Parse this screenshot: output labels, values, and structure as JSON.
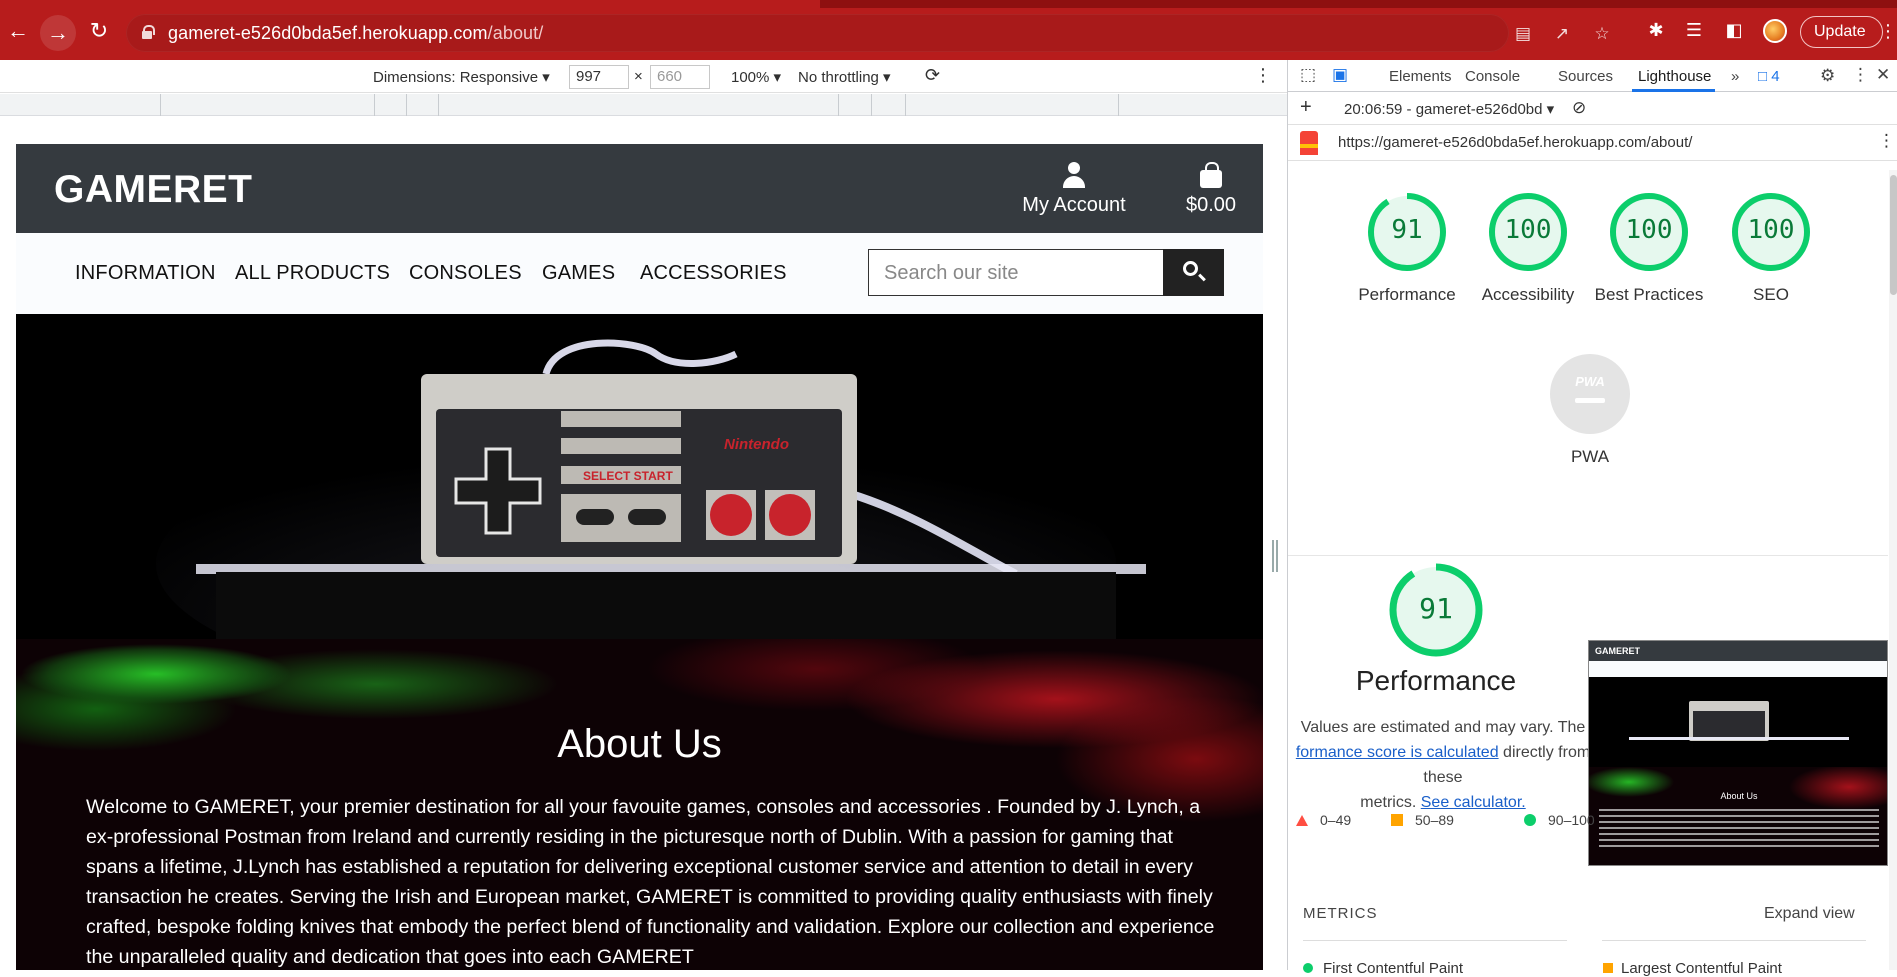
{
  "browser": {
    "url_host": "gameret-e526d0bda5ef.herokuapp.com",
    "url_path": "/about/",
    "update_label": "Update"
  },
  "device_toolbar": {
    "dimensions_label": "Dimensions: Responsive",
    "width_value": "997",
    "height_placeholder": "660",
    "zoom": "100%",
    "throttling": "No throttling"
  },
  "devtools": {
    "tabs": [
      "Elements",
      "Console",
      "Sources",
      "Lighthouse"
    ],
    "issues_count": "4",
    "report_time": "20:06:59 - gameret-e526d0bd",
    "report_url": "https://gameret-e526d0bda5ef.herokuapp.com/about/",
    "scores": [
      {
        "label": "Performance",
        "value": "91",
        "fraction": 0.91
      },
      {
        "label": "Accessibility",
        "value": "100",
        "fraction": 1.0
      },
      {
        "label": "Best Practices",
        "value": "100",
        "fraction": 1.0
      },
      {
        "label": "SEO",
        "value": "100",
        "fraction": 1.0
      }
    ],
    "pwa_badge": "PWA",
    "pwa_label": "PWA",
    "perf_score": "91",
    "perf_title": "Performance",
    "perf_note_1": "Values are estimated and may vary. The",
    "perf_note_link": "formance score is calculated",
    "perf_note_2": "directly from these",
    "perf_note_3": "metrics.",
    "perf_note_link2": "See calculator.",
    "legend": {
      "fail": "0–49",
      "average": "50–89",
      "pass": "90–100"
    },
    "metrics_heading": "METRICS",
    "expand_view": "Expand view",
    "metric_fcp": "First Contentful Paint",
    "metric_lcp": "Largest Contentful Paint",
    "thumb_about": "About Us"
  },
  "site": {
    "brand": "GAMERET",
    "account_label": "My Account",
    "cart_total": "$0.00",
    "nav": [
      "INFORMATION",
      "ALL PRODUCTS",
      "CONSOLES",
      "GAMES",
      "ACCESSORIES"
    ],
    "search_placeholder": "Search our site",
    "hero_brand": "Nintendo",
    "hero_select_start": "SELECT START",
    "about_title": "About Us",
    "about_text": "Welcome to GAMERET, your premier destination for all your favouite games, consoles and accessories . Founded by J. Lynch, a ex-professional Postman from Ireland and currently residing in the picturesque north of Dublin. With a passion for gaming that spans a lifetime, J.Lynch has established a reputation for delivering exceptional customer service and attention to detail in every transaction he creates. Serving the Irish and European market, GAMERET is committed to providing quality enthusiasts with finely crafted, bespoke folding knives that embody the perfect blend of functionality and validation. Explore our collection and experience the unparalleled quality and dedication that goes into each GAMERET"
  },
  "colors": {
    "chrome_red": "#b71c1c",
    "score_green": "#0cce6b",
    "score_text": "#0a7a38",
    "average_orange": "#ffa400"
  }
}
